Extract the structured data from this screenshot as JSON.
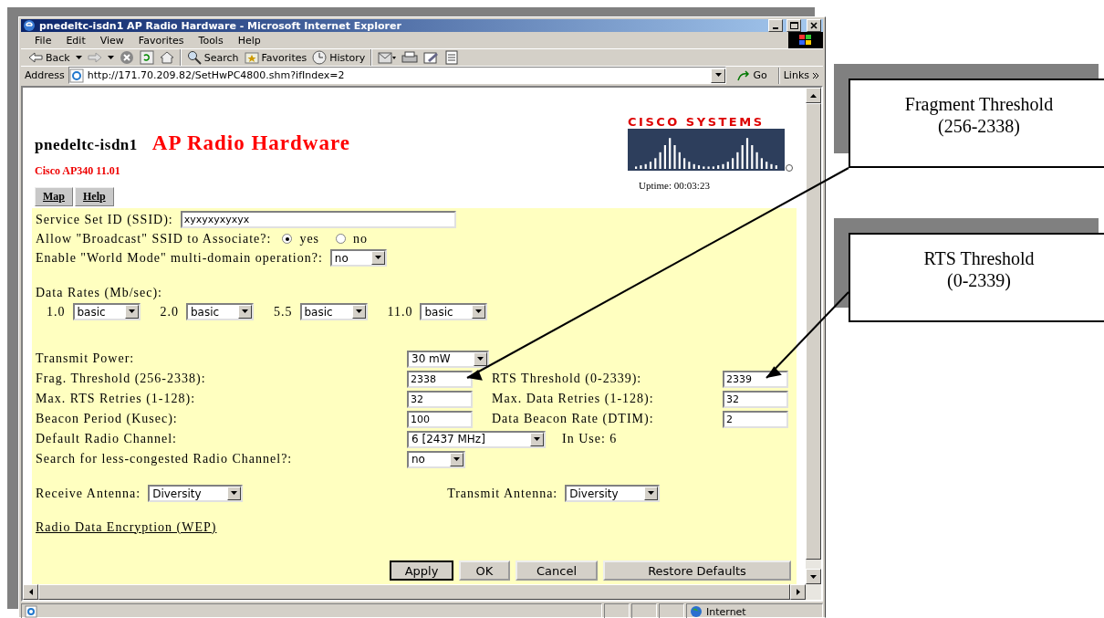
{
  "window": {
    "title": "pnedeltc-isdn1 AP Radio Hardware - Microsoft Internet Explorer"
  },
  "menu": [
    "File",
    "Edit",
    "View",
    "Favorites",
    "Tools",
    "Help"
  ],
  "toolbar": [
    {
      "kind": "back",
      "label": "Back"
    },
    {
      "kind": "forward"
    },
    {
      "kind": "stop"
    },
    {
      "kind": "refresh"
    },
    {
      "kind": "home"
    },
    {
      "kind": "search",
      "label": "Search"
    },
    {
      "kind": "favorites",
      "label": "Favorites"
    },
    {
      "kind": "history",
      "label": "History"
    },
    {
      "kind": "mail"
    },
    {
      "kind": "print"
    },
    {
      "kind": "edit"
    },
    {
      "kind": "discuss"
    }
  ],
  "address": {
    "label": "Address",
    "url": "http://171.70.209.82/SetHwPC4800.shm?ifIndex=2",
    "go": "Go",
    "links": "Links"
  },
  "page": {
    "host": "pnedeltc-isdn1",
    "title": "AP Radio Hardware",
    "model": "Cisco AP340 11.01",
    "nav": [
      "Map",
      "Help"
    ],
    "brand": "CISCO SYSTEMS",
    "uptime": "Uptime: 00:03:23"
  },
  "form": {
    "ssid": {
      "label": "Service Set ID (SSID):",
      "value": "xyxyxyxyxyx"
    },
    "broadcast": {
      "label": "Allow \"Broadcast\" SSID to Associate?:",
      "options": [
        {
          "label": "yes",
          "selected": true
        },
        {
          "label": "no",
          "selected": false
        }
      ]
    },
    "world_mode": {
      "label": "Enable \"World Mode\" multi-domain operation?:",
      "value": "no"
    },
    "data_rates": {
      "label": "Data Rates  (Mb/sec):",
      "rates": [
        {
          "rate": "1.0",
          "value": "basic"
        },
        {
          "rate": "2.0",
          "value": "basic"
        },
        {
          "rate": "5.5",
          "value": "basic"
        },
        {
          "rate": "11.0",
          "value": "basic"
        }
      ]
    },
    "transmit_power": {
      "label": "Transmit Power:",
      "value": "30 mW"
    },
    "pairs": [
      {
        "label": "Frag. Threshold (256-2338):",
        "value": "2338",
        "label2": "RTS Threshold (0-2339):",
        "value2": "2339"
      },
      {
        "label": "Max. RTS Retries (1-128):",
        "value": "32",
        "label2": "Max. Data Retries (1-128):",
        "value2": "32"
      },
      {
        "label": "Beacon Period (Kusec):",
        "value": "100",
        "label2": "Data Beacon Rate (DTIM):",
        "value2": "2"
      }
    ],
    "default_channel": {
      "label": "Default Radio Channel:",
      "value": "6  [2437 MHz]",
      "in_use": "In Use: 6"
    },
    "search_channel": {
      "label": "Search for less-congested Radio Channel?:",
      "value": "no"
    },
    "receive_antenna": {
      "label": "Receive Antenna:",
      "value": "Diversity"
    },
    "transmit_antenna": {
      "label": "Transmit Antenna:",
      "value": "Diversity"
    },
    "link": "Radio Data Encryption (WEP)",
    "buttons": [
      {
        "label": "Apply",
        "default": true
      },
      {
        "label": "OK",
        "default": false
      },
      {
        "label": "Cancel",
        "default": false
      },
      {
        "label": "Restore Defaults",
        "default": false
      }
    ]
  },
  "status_bar": {
    "zone": "Internet"
  },
  "callouts": [
    {
      "title": "Fragment Threshold",
      "range": "(256-2338)"
    },
    {
      "title": "RTS Threshold",
      "range": "(0-2339)"
    }
  ]
}
